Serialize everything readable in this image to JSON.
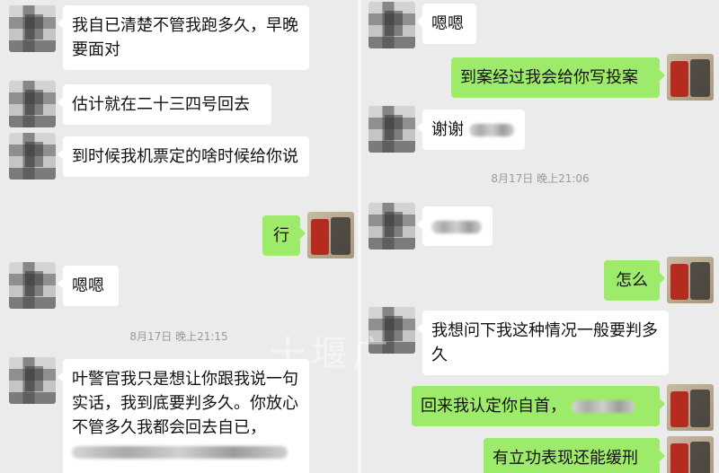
{
  "left": {
    "messages": [
      {
        "dir": "in",
        "text": "我自已清楚不管我跑多久，早晚要面对"
      },
      {
        "dir": "in",
        "text": "估计就在二十三四号回去"
      },
      {
        "dir": "in",
        "text": "到时候我机票定的啥时候给你说"
      },
      {
        "dir": "out",
        "text": "行"
      },
      {
        "dir": "in",
        "text": "嗯嗯"
      },
      {
        "dir": "time",
        "text": "8月17日 晚上21:15"
      },
      {
        "dir": "in",
        "text": "叶警官我只是想让你跟我说一句实话，我到底要判多久。你放心不管多久我都会回去自已，"
      }
    ]
  },
  "right": {
    "messages": [
      {
        "dir": "in",
        "text": "嗯嗯"
      },
      {
        "dir": "out",
        "text": "到案经过我会给你写投案"
      },
      {
        "dir": "in",
        "text": "谢谢"
      },
      {
        "dir": "time",
        "text": "8月17日 晚上21:06"
      },
      {
        "dir": "in",
        "text": ""
      },
      {
        "dir": "out",
        "text": "怎么"
      },
      {
        "dir": "in",
        "text": "我想问下我这种情况一般要判多久"
      },
      {
        "dir": "out",
        "text": "回来我认定你自首，"
      },
      {
        "dir": "out",
        "text": "有立功表现还能缓刑"
      }
    ]
  },
  "watermark": "十堰广"
}
